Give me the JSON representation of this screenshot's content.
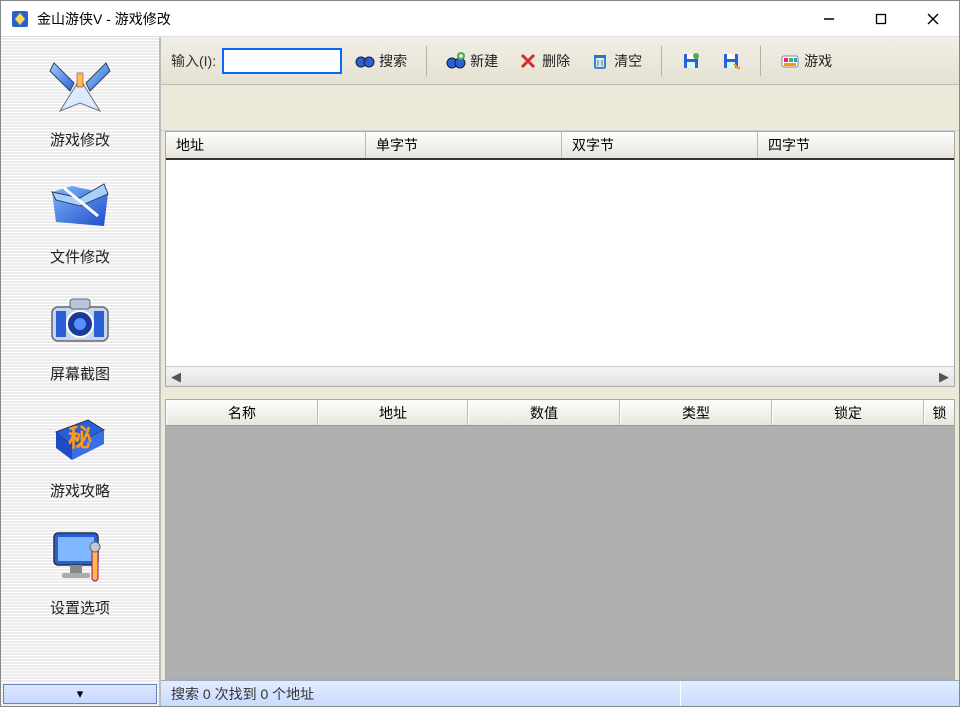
{
  "window": {
    "title": "金山游侠V - 游戏修改"
  },
  "sidebar": {
    "items": [
      {
        "label": "游戏修改",
        "icon": "swords"
      },
      {
        "label": "文件修改",
        "icon": "folder"
      },
      {
        "label": "屏幕截图",
        "icon": "camera"
      },
      {
        "label": "游戏攻略",
        "icon": "book"
      },
      {
        "label": "设置选项",
        "icon": "monitor"
      }
    ]
  },
  "toolbar": {
    "input_label": "输入(I):",
    "input_value": "",
    "search": "搜索",
    "new": "新建",
    "delete": "删除",
    "clear": "清空",
    "game": "游戏"
  },
  "grid1": {
    "columns": [
      "地址",
      "单字节",
      "双字节",
      "四字节"
    ]
  },
  "grid2": {
    "columns": [
      "名称",
      "地址",
      "数值",
      "类型",
      "锁定",
      "锁"
    ]
  },
  "statusbar": {
    "text": "搜索 0 次找到 0 个地址"
  }
}
